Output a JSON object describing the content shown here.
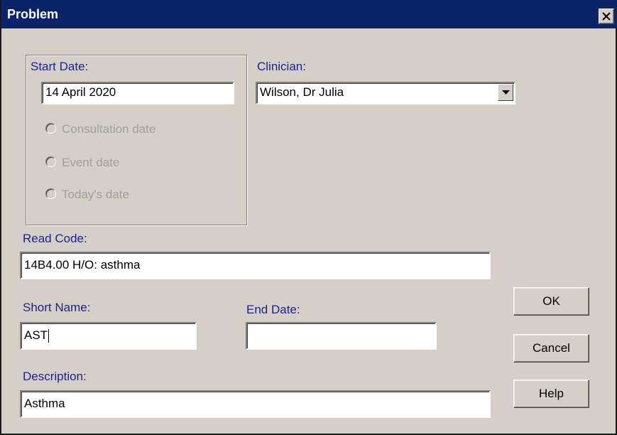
{
  "window": {
    "title": "Problem"
  },
  "start_date": {
    "label": "Start Date:",
    "value": "14 April 2020",
    "options": [
      "Consultation date",
      "Event date",
      "Today's date"
    ]
  },
  "clinician": {
    "label": "Clinician:",
    "value": "Wilson, Dr Julia"
  },
  "read_code": {
    "label": "Read Code:",
    "value": "14B4.00 H/O: asthma"
  },
  "short_name": {
    "label": "Short Name:",
    "value": "AST"
  },
  "end_date": {
    "label": "End Date:",
    "value": ""
  },
  "description": {
    "label": "Description:",
    "value": "Asthma"
  },
  "buttons": {
    "ok": "OK",
    "cancel": "Cancel",
    "help": "Help"
  },
  "colors": {
    "titlebar": "#0a246a",
    "dialog_bg": "#d4d0c8",
    "label_text": "#1f1f8f",
    "disabled_text": "#a0a0a0"
  }
}
